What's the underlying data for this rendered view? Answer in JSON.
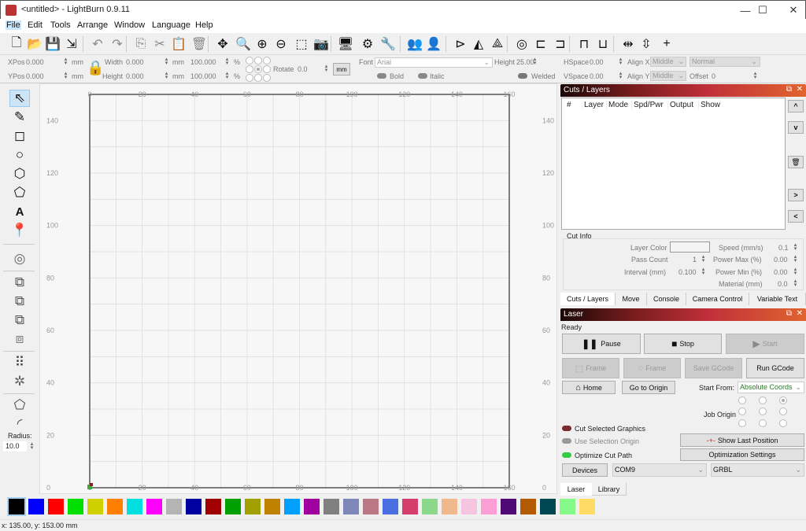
{
  "window": {
    "title": "<untitled> - LightBurn 0.9.11",
    "controls": {
      "minimize": "—",
      "maximize": "☐",
      "close": "✕"
    }
  },
  "menu": [
    "File",
    "Edit",
    "Tools",
    "Arrange",
    "Window",
    "Language",
    "Help"
  ],
  "toolbar": {
    "icons": [
      "new-file",
      "open-folder",
      "save",
      "import",
      "undo",
      "redo",
      "copy",
      "cut",
      "paste",
      "delete",
      "move",
      "zoom-to-frame",
      "zoom-in",
      "zoom-out",
      "zoom-selection",
      "camera",
      "monitor",
      "settings",
      "tools",
      "group",
      "ungroup",
      "mirror-h",
      "mirror-v",
      "flip",
      "center",
      "align-left",
      "align-right",
      "align-top",
      "align-bottom",
      "distribute-h",
      "distribute-v",
      "move-together"
    ],
    "glyphs": [
      "🗋",
      "📂",
      "💾",
      "⇲",
      "↶",
      "↷",
      "⎘",
      "✂",
      "📋",
      "🗑",
      "✥",
      "🔍",
      "⊕",
      "⊖",
      "⬚",
      "📷",
      "🖥",
      "⚙",
      "🔧",
      "👥",
      "👤",
      "⊳",
      "◭",
      "⟁",
      "◎",
      "⊏",
      "⊐",
      "⊓",
      "⊔",
      "⇹",
      "⇳",
      "+"
    ]
  },
  "props": {
    "xpos_label": "XPos",
    "xpos": "0.000",
    "ypos_label": "YPos",
    "ypos": "0.000",
    "unit": "mm",
    "width_label": "Width",
    "width": "0.000",
    "height_label": "Height",
    "height": "0.000",
    "scale_w": "100.000",
    "scale_h": "100.000",
    "pct": "%",
    "rotate_label": "Rotate",
    "rotate": "0.0",
    "unit_button": "mm",
    "font_label": "Font",
    "font": "Arial",
    "text_height_label": "Height",
    "text_height": "25.00",
    "hspace_label": "HSpace",
    "hspace": "0.00",
    "vspace_label": "VSpace",
    "vspace": "0.00",
    "alignx_label": "Align X",
    "alignx": "Middle",
    "aligny_label": "Align Y",
    "aligny": "Middle",
    "style": "Normal",
    "offset_label": "Offset",
    "offset": "0",
    "bold": "Bold",
    "italic": "Italic",
    "welded": "Welded"
  },
  "tools": {
    "items": [
      "select",
      "draw-lines",
      "rectangle",
      "ellipse",
      "polygon",
      "edit-nodes",
      "text",
      "position-laser",
      "offset",
      "boolean-union",
      "boolean-subtract",
      "boolean-intersect",
      "weld",
      "grid-array",
      "circular-array",
      "convert-to-path",
      "corner-radius"
    ],
    "radius_label": "Radius:",
    "radius": "10.0"
  },
  "canvas": {
    "x_ticks": [
      "0",
      "20",
      "40",
      "60",
      "80",
      "100",
      "120",
      "140",
      "160"
    ],
    "y_ticks": [
      "140",
      "120",
      "100",
      "80",
      "60",
      "40",
      "20",
      "0"
    ],
    "grid_color": "#e2e2e2",
    "border_color": "#555555"
  },
  "cuts": {
    "title": "Cuts / Layers",
    "columns": [
      "#",
      "Layer",
      "Mode",
      "Spd/Pwr",
      "Output",
      "Show"
    ],
    "side_buttons": [
      "^",
      "v",
      "🗑",
      ">",
      "<"
    ],
    "cut_info": {
      "title": "Cut Info",
      "layer_color_label": "Layer Color",
      "pass_count_label": "Pass Count",
      "pass_count": "1",
      "interval_label": "Interval (mm)",
      "interval": "0.100",
      "speed_label": "Speed (mm/s)",
      "speed": "0.1",
      "power_max_label": "Power Max (%)",
      "power_max": "0.00",
      "power_min_label": "Power Min (%)",
      "power_min": "0.00",
      "material_label": "Material (mm)",
      "material": "0.0"
    },
    "tabs": [
      "Cuts / Layers",
      "Move",
      "Console",
      "Camera Control",
      "Variable Text"
    ]
  },
  "laser": {
    "title": "Laser",
    "status": "Ready",
    "pause": "Pause",
    "stop": "Stop",
    "start": "Start",
    "frame1": "Frame",
    "frame2": "Frame",
    "save_gcode": "Save GCode",
    "run_gcode": "Run GCode",
    "home": "Home",
    "go_to_origin": "Go to Origin",
    "start_from_label": "Start From:",
    "start_from": "Absolute Coords",
    "job_origin_label": "Job Origin",
    "cut_selected": "Cut Selected Graphics",
    "use_selection_origin": "Use Selection Origin",
    "optimize_cut_path": "Optimize Cut Path",
    "show_last_position": "Show Last Position",
    "optimization_settings": "Optimization Settings",
    "devices": "Devices",
    "port": "COM9",
    "controller": "GRBL",
    "tabs": [
      "Laser",
      "Library"
    ]
  },
  "palette": [
    "#000000",
    "#0000ff",
    "#ff0000",
    "#00e000",
    "#d0d000",
    "#ff8000",
    "#00e0e0",
    "#ff00ff",
    "#b4b4b4",
    "#0000a0",
    "#a00000",
    "#00a000",
    "#a0a000",
    "#c08000",
    "#00a0ff",
    "#a000a0",
    "#808080",
    "#7d87b9",
    "#bb7784",
    "#4a6fe3",
    "#d33f6a",
    "#8cd78c",
    "#f0b98d",
    "#f6c4e1",
    "#fa9ed4",
    "#500a78",
    "#b45a00",
    "#004754",
    "#86fa88",
    "#ffdb66"
  ],
  "status": {
    "coords": "x: 135.00, y: 153.00 mm"
  }
}
